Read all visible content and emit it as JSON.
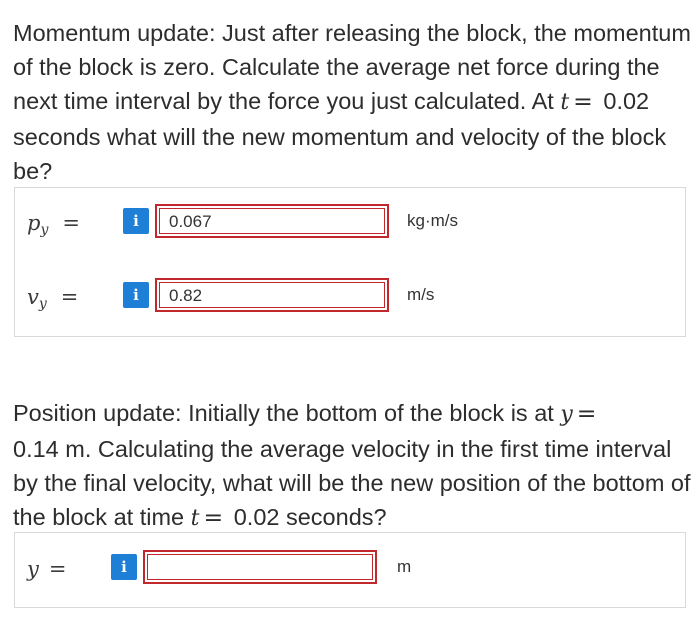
{
  "question1": {
    "text_a": "Momentum update: Just after releasing the block, the momentum of the block is zero. Calculate the average net force during the next time interval by the force you just calculated. At",
    "var_t": "t",
    "equals": "=",
    "text_b": "0.02 seconds what will the new momentum and velocity of the block be?"
  },
  "panel1": {
    "rows": [
      {
        "var": "p",
        "sub": "y",
        "equals": "=",
        "info": "i",
        "value": "0.067",
        "unit": "kg·m/s"
      },
      {
        "var": "v",
        "sub": "y",
        "equals": "=",
        "info": "i",
        "value": "0.82",
        "unit": "m/s"
      }
    ]
  },
  "question2": {
    "text_a": "Position update: Initially the bottom of the block is at",
    "var_y": "y",
    "equals1": "=",
    "text_b": "0.14 m. Calculating the average velocity in the first time interval by the final velocity, what will be the new position of the bottom of the block at time",
    "var_t": "t",
    "equals2": "=",
    "text_c": "0.02 seconds?"
  },
  "panel2": {
    "row": {
      "var": "y",
      "equals": "=",
      "info": "i",
      "value": "",
      "unit": "m"
    }
  },
  "colors": {
    "info_button": "#1e7fd6",
    "input_border": "#c1272d",
    "panel_border": "#d9d9d9"
  }
}
